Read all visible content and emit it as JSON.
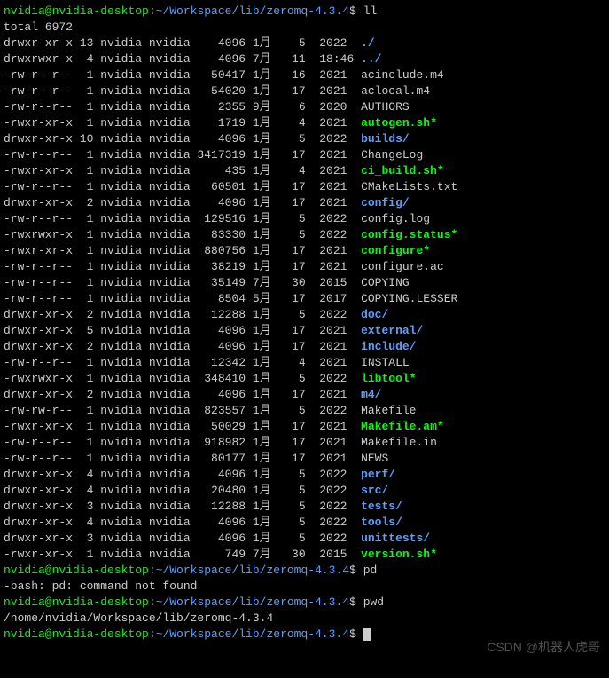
{
  "prompt": {
    "user": "nvidia@nvidia-desktop",
    "sep1": ":",
    "path": "~/Workspace/lib/zeromq-4.3.4",
    "sep2": "$ "
  },
  "cmd1": "ll",
  "total": "total 6972",
  "entries": [
    {
      "perm": "drwxr-xr-x",
      "lnk": "13",
      "o": "nvidia",
      "g": "nvidia",
      "sz": "4096",
      "m": "1月",
      "d": "5",
      "t": "2022",
      "name": "./",
      "cls": "dir"
    },
    {
      "perm": "drwxrwxr-x",
      "lnk": "4",
      "o": "nvidia",
      "g": "nvidia",
      "sz": "4096",
      "m": "7月",
      "d": "11",
      "t": "18:46",
      "name": "../",
      "cls": "dir"
    },
    {
      "perm": "-rw-r--r--",
      "lnk": "1",
      "o": "nvidia",
      "g": "nvidia",
      "sz": "50417",
      "m": "1月",
      "d": "16",
      "t": "2021",
      "name": "acinclude.m4",
      "cls": "white"
    },
    {
      "perm": "-rw-r--r--",
      "lnk": "1",
      "o": "nvidia",
      "g": "nvidia",
      "sz": "54020",
      "m": "1月",
      "d": "17",
      "t": "2021",
      "name": "aclocal.m4",
      "cls": "white"
    },
    {
      "perm": "-rw-r--r--",
      "lnk": "1",
      "o": "nvidia",
      "g": "nvidia",
      "sz": "2355",
      "m": "9月",
      "d": "6",
      "t": "2020",
      "name": "AUTHORS",
      "cls": "white"
    },
    {
      "perm": "-rwxr-xr-x",
      "lnk": "1",
      "o": "nvidia",
      "g": "nvidia",
      "sz": "1719",
      "m": "1月",
      "d": "4",
      "t": "2021",
      "name": "autogen.sh*",
      "cls": "exec"
    },
    {
      "perm": "drwxr-xr-x",
      "lnk": "10",
      "o": "nvidia",
      "g": "nvidia",
      "sz": "4096",
      "m": "1月",
      "d": "5",
      "t": "2022",
      "name": "builds/",
      "cls": "dir"
    },
    {
      "perm": "-rw-r--r--",
      "lnk": "1",
      "o": "nvidia",
      "g": "nvidia",
      "sz": "3417319",
      "m": "1月",
      "d": "17",
      "t": "2021",
      "name": "ChangeLog",
      "cls": "white"
    },
    {
      "perm": "-rwxr-xr-x",
      "lnk": "1",
      "o": "nvidia",
      "g": "nvidia",
      "sz": "435",
      "m": "1月",
      "d": "4",
      "t": "2021",
      "name": "ci_build.sh*",
      "cls": "exec"
    },
    {
      "perm": "-rw-r--r--",
      "lnk": "1",
      "o": "nvidia",
      "g": "nvidia",
      "sz": "60501",
      "m": "1月",
      "d": "17",
      "t": "2021",
      "name": "CMakeLists.txt",
      "cls": "white"
    },
    {
      "perm": "drwxr-xr-x",
      "lnk": "2",
      "o": "nvidia",
      "g": "nvidia",
      "sz": "4096",
      "m": "1月",
      "d": "17",
      "t": "2021",
      "name": "config/",
      "cls": "dir"
    },
    {
      "perm": "-rw-r--r--",
      "lnk": "1",
      "o": "nvidia",
      "g": "nvidia",
      "sz": "129516",
      "m": "1月",
      "d": "5",
      "t": "2022",
      "name": "config.log",
      "cls": "white"
    },
    {
      "perm": "-rwxrwxr-x",
      "lnk": "1",
      "o": "nvidia",
      "g": "nvidia",
      "sz": "83330",
      "m": "1月",
      "d": "5",
      "t": "2022",
      "name": "config.status*",
      "cls": "exec"
    },
    {
      "perm": "-rwxr-xr-x",
      "lnk": "1",
      "o": "nvidia",
      "g": "nvidia",
      "sz": "880756",
      "m": "1月",
      "d": "17",
      "t": "2021",
      "name": "configure*",
      "cls": "exec"
    },
    {
      "perm": "-rw-r--r--",
      "lnk": "1",
      "o": "nvidia",
      "g": "nvidia",
      "sz": "38219",
      "m": "1月",
      "d": "17",
      "t": "2021",
      "name": "configure.ac",
      "cls": "white"
    },
    {
      "perm": "-rw-r--r--",
      "lnk": "1",
      "o": "nvidia",
      "g": "nvidia",
      "sz": "35149",
      "m": "7月",
      "d": "30",
      "t": "2015",
      "name": "COPYING",
      "cls": "white"
    },
    {
      "perm": "-rw-r--r--",
      "lnk": "1",
      "o": "nvidia",
      "g": "nvidia",
      "sz": "8504",
      "m": "5月",
      "d": "17",
      "t": "2017",
      "name": "COPYING.LESSER",
      "cls": "white"
    },
    {
      "perm": "drwxr-xr-x",
      "lnk": "2",
      "o": "nvidia",
      "g": "nvidia",
      "sz": "12288",
      "m": "1月",
      "d": "5",
      "t": "2022",
      "name": "doc/",
      "cls": "dir"
    },
    {
      "perm": "drwxr-xr-x",
      "lnk": "5",
      "o": "nvidia",
      "g": "nvidia",
      "sz": "4096",
      "m": "1月",
      "d": "17",
      "t": "2021",
      "name": "external/",
      "cls": "dir"
    },
    {
      "perm": "drwxr-xr-x",
      "lnk": "2",
      "o": "nvidia",
      "g": "nvidia",
      "sz": "4096",
      "m": "1月",
      "d": "17",
      "t": "2021",
      "name": "include/",
      "cls": "dir"
    },
    {
      "perm": "-rw-r--r--",
      "lnk": "1",
      "o": "nvidia",
      "g": "nvidia",
      "sz": "12342",
      "m": "1月",
      "d": "4",
      "t": "2021",
      "name": "INSTALL",
      "cls": "white"
    },
    {
      "perm": "-rwxrwxr-x",
      "lnk": "1",
      "o": "nvidia",
      "g": "nvidia",
      "sz": "348410",
      "m": "1月",
      "d": "5",
      "t": "2022",
      "name": "libtool*",
      "cls": "exec"
    },
    {
      "perm": "drwxr-xr-x",
      "lnk": "2",
      "o": "nvidia",
      "g": "nvidia",
      "sz": "4096",
      "m": "1月",
      "d": "17",
      "t": "2021",
      "name": "m4/",
      "cls": "dir"
    },
    {
      "perm": "-rw-rw-r--",
      "lnk": "1",
      "o": "nvidia",
      "g": "nvidia",
      "sz": "823557",
      "m": "1月",
      "d": "5",
      "t": "2022",
      "name": "Makefile",
      "cls": "white"
    },
    {
      "perm": "-rwxr-xr-x",
      "lnk": "1",
      "o": "nvidia",
      "g": "nvidia",
      "sz": "50029",
      "m": "1月",
      "d": "17",
      "t": "2021",
      "name": "Makefile.am*",
      "cls": "exec"
    },
    {
      "perm": "-rw-r--r--",
      "lnk": "1",
      "o": "nvidia",
      "g": "nvidia",
      "sz": "918982",
      "m": "1月",
      "d": "17",
      "t": "2021",
      "name": "Makefile.in",
      "cls": "white"
    },
    {
      "perm": "-rw-r--r--",
      "lnk": "1",
      "o": "nvidia",
      "g": "nvidia",
      "sz": "80177",
      "m": "1月",
      "d": "17",
      "t": "2021",
      "name": "NEWS",
      "cls": "white"
    },
    {
      "perm": "drwxr-xr-x",
      "lnk": "4",
      "o": "nvidia",
      "g": "nvidia",
      "sz": "4096",
      "m": "1月",
      "d": "5",
      "t": "2022",
      "name": "perf/",
      "cls": "dir"
    },
    {
      "perm": "drwxr-xr-x",
      "lnk": "4",
      "o": "nvidia",
      "g": "nvidia",
      "sz": "20480",
      "m": "1月",
      "d": "5",
      "t": "2022",
      "name": "src/",
      "cls": "dir"
    },
    {
      "perm": "drwxr-xr-x",
      "lnk": "3",
      "o": "nvidia",
      "g": "nvidia",
      "sz": "12288",
      "m": "1月",
      "d": "5",
      "t": "2022",
      "name": "tests/",
      "cls": "dir"
    },
    {
      "perm": "drwxr-xr-x",
      "lnk": "4",
      "o": "nvidia",
      "g": "nvidia",
      "sz": "4096",
      "m": "1月",
      "d": "5",
      "t": "2022",
      "name": "tools/",
      "cls": "dir"
    },
    {
      "perm": "drwxr-xr-x",
      "lnk": "3",
      "o": "nvidia",
      "g": "nvidia",
      "sz": "4096",
      "m": "1月",
      "d": "5",
      "t": "2022",
      "name": "unittests/",
      "cls": "dir"
    },
    {
      "perm": "-rwxr-xr-x",
      "lnk": "1",
      "o": "nvidia",
      "g": "nvidia",
      "sz": "749",
      "m": "7月",
      "d": "30",
      "t": "2015",
      "name": "version.sh*",
      "cls": "exec"
    }
  ],
  "cmd2": "pd",
  "err": "-bash: pd: command not found",
  "cmd3": "pwd",
  "pwd_out": "/home/nvidia/Workspace/lib/zeromq-4.3.4",
  "watermark": "CSDN @机器人虎哥"
}
